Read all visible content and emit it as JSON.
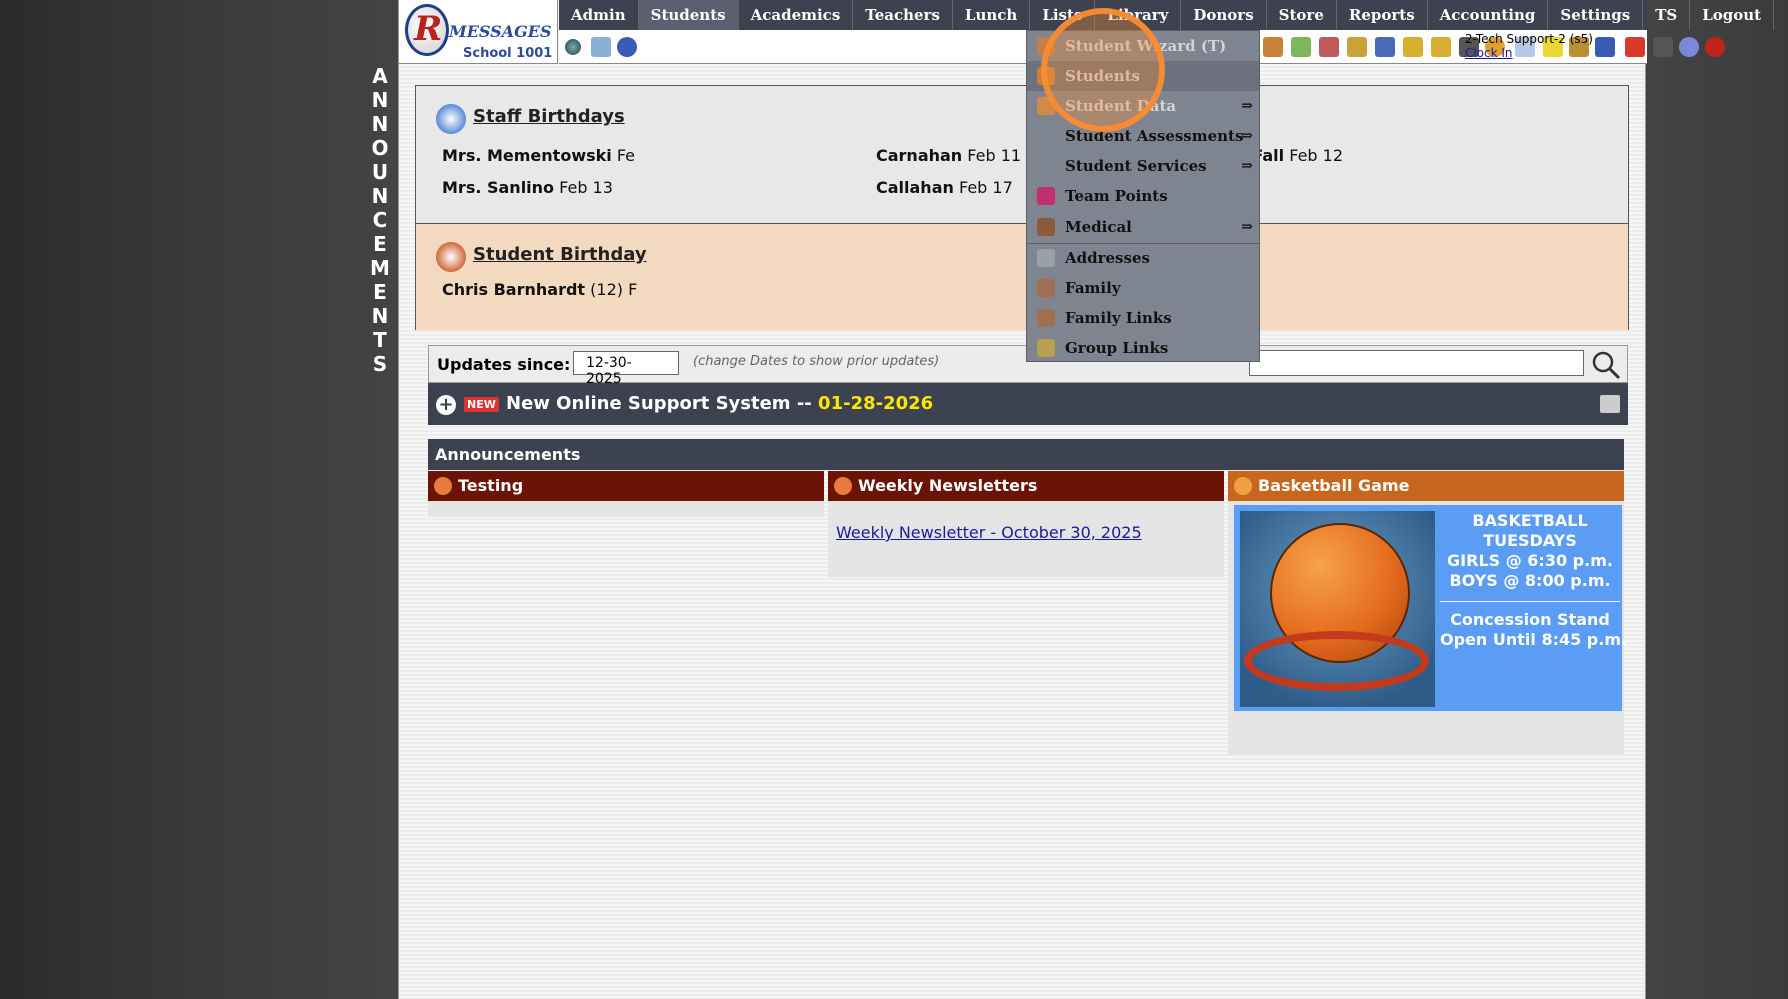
{
  "vertical_label": [
    "A",
    "N",
    "N",
    "O",
    "U",
    "N",
    "C",
    "E",
    "M",
    "E",
    "N",
    "T",
    "S"
  ],
  "logo": {
    "main": "MESSAGES",
    "sub": "School 1001"
  },
  "topnav": [
    "Admin",
    "Students",
    "Academics",
    "Teachers",
    "Lunch",
    "Lists",
    "Library",
    "Donors",
    "Store",
    "Reports",
    "Accounting",
    "Settings",
    "TS",
    "Logout"
  ],
  "user": {
    "name": "2-Tech Support-2 (s5)",
    "clock": "Clock In"
  },
  "staff_birthdays": {
    "title": "Staff Birthdays",
    "entries": [
      {
        "name": "Mrs. Mementowski",
        "date": "Fe"
      },
      {
        "name": "Carnahan",
        "date": "Feb 11"
      },
      {
        "name": "Mrs. McFall",
        "date": "Feb 12"
      },
      {
        "name": "Mrs. Sanlino",
        "date": "Feb 13"
      },
      {
        "name": "Callahan",
        "date": "Feb 17"
      }
    ]
  },
  "student_birthdays": {
    "title": "Student Birthday",
    "entries": [
      {
        "name": "Chris Barnhardt",
        "detail": "(12) F"
      }
    ]
  },
  "updates": {
    "label": "Updates since:",
    "date_value": "12-30-2025",
    "hint": "(change Dates to show prior updates)"
  },
  "support": {
    "text": "New Online Support System --",
    "date": "01-28-2026",
    "badge": "NEW"
  },
  "announcements": {
    "header": "Announcements",
    "columns": [
      {
        "title": "Testing",
        "color": "#6b1406"
      },
      {
        "title": "Weekly Newsletters",
        "color": "#6b1406",
        "link": "Weekly Newsletter - October 30, 2025"
      },
      {
        "title": "Basketball Game",
        "color": "#c7661d"
      }
    ],
    "basketball": {
      "lines": [
        "BASKETBALL",
        "TUESDAYS",
        "GIRLS @ 6:30 p.m.",
        "BOYS  @ 8:00 p.m."
      ],
      "lines2": [
        "Concession Stand",
        "Open Until 8:45 p.m."
      ]
    }
  },
  "dropdown": [
    {
      "label": "Student Wizard (T)",
      "faded": true,
      "icon_color": "#c97b4a"
    },
    {
      "label": "Students",
      "faded": true,
      "active": true,
      "icon_color": "#c9833a"
    },
    {
      "label": "Student Data",
      "faded": true,
      "arrow": "⇒",
      "icon_color": "#d28a4a"
    },
    {
      "label": "Student Assessments",
      "arrow": "⇒",
      "icon_color": ""
    },
    {
      "label": "Student Services",
      "arrow": "⇒",
      "icon_color": ""
    },
    {
      "label": "Team Points",
      "icon_color": "#c0306e"
    },
    {
      "label": "Medical",
      "arrow": "⇒",
      "icon_color": "#8a5a3a"
    },
    {
      "label": "Addresses",
      "icon_color": "#9aa0aa"
    },
    {
      "label": "Family",
      "icon_color": "#a07050"
    },
    {
      "label": "Family Links",
      "icon_color": "#a07050"
    },
    {
      "label": "Group Links",
      "icon_color": "#b8a050"
    }
  ]
}
